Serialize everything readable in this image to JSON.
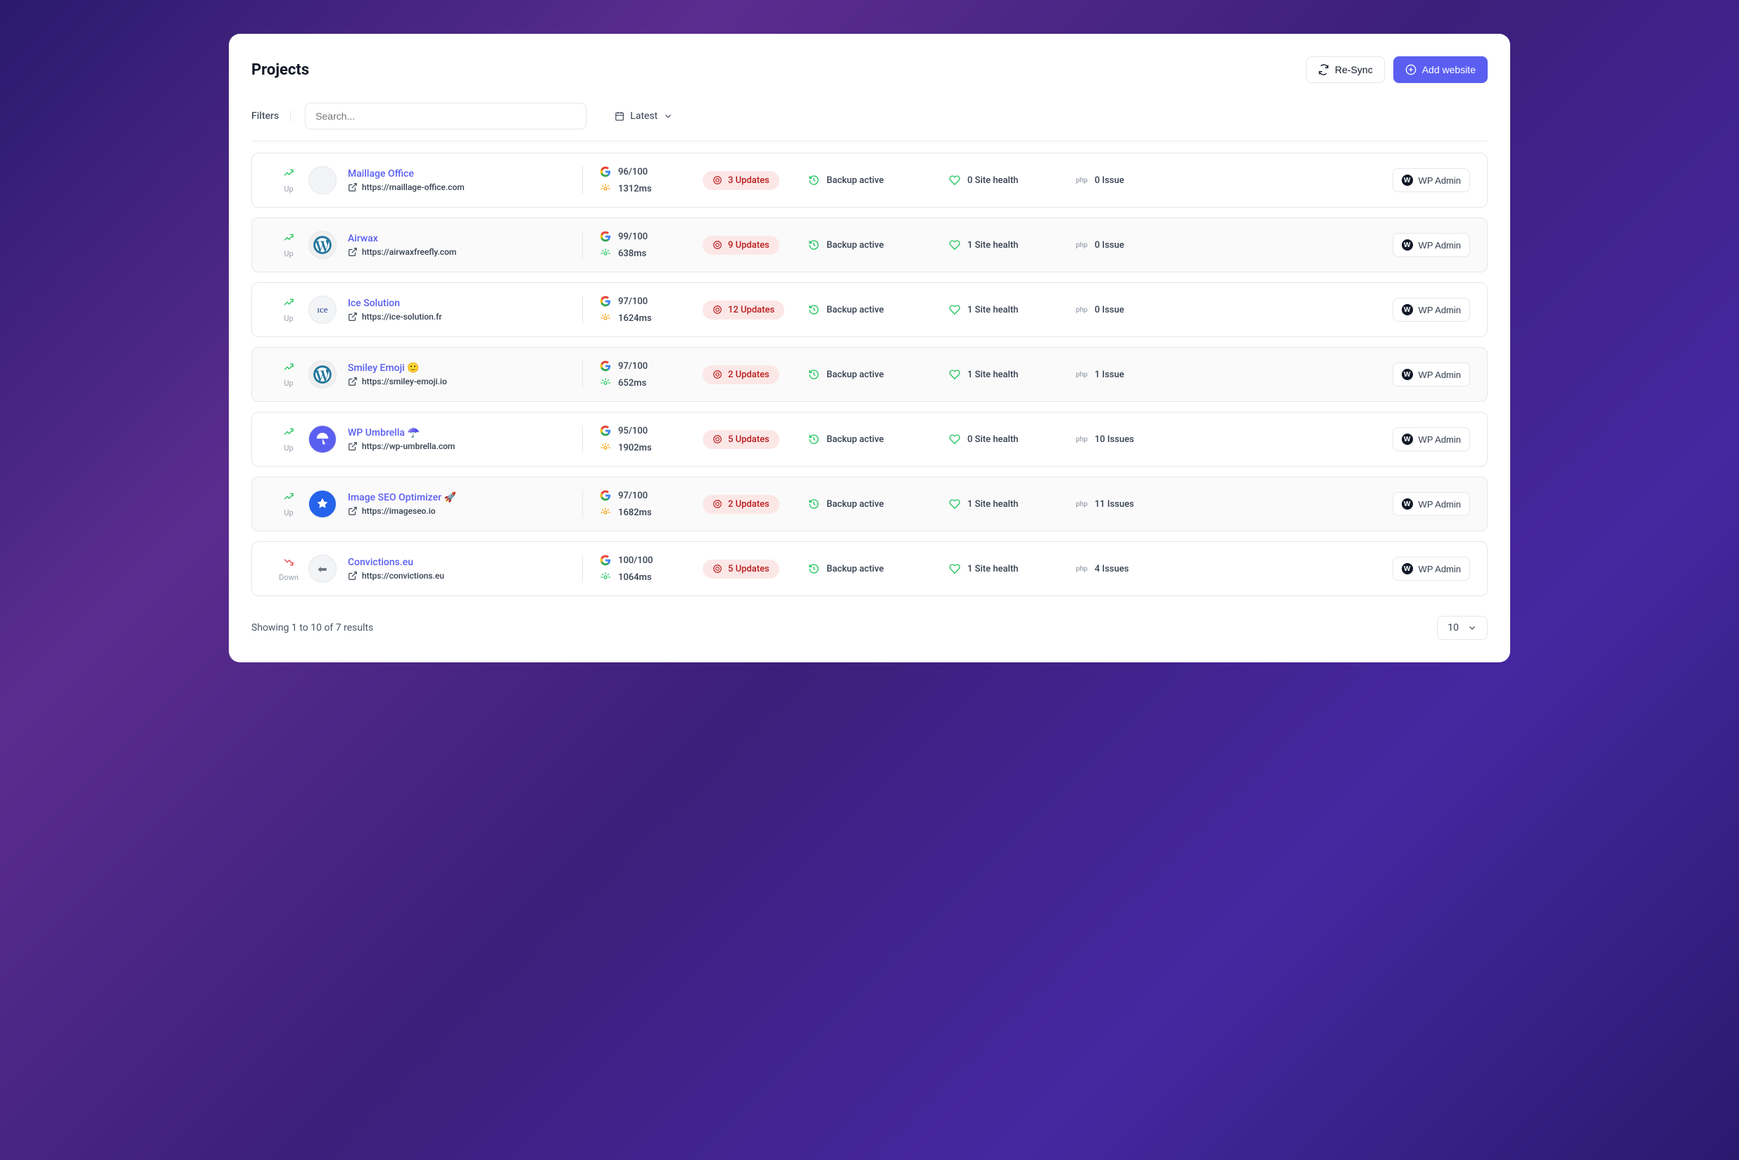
{
  "header": {
    "title": "Projects",
    "resync_label": "Re-Sync",
    "add_website_label": "Add website"
  },
  "toolbar": {
    "filters_label": "Filters",
    "search_placeholder": "Search...",
    "sort_label": "Latest"
  },
  "rows": [
    {
      "status": "Up",
      "trend": "up",
      "favicon": "blank",
      "name": "Maillage Office",
      "url": "https://maillage-office.com",
      "score": "96/100",
      "speed": "1312ms",
      "speed_color": "amber",
      "updates": "3 Updates",
      "backup": "Backup active",
      "health": "0 Site health",
      "issues": "0 Issue",
      "admin": "WP Admin"
    },
    {
      "status": "Up",
      "trend": "up",
      "favicon": "wp",
      "name": "Airwax",
      "url": "https://airwaxfreefly.com",
      "score": "99/100",
      "speed": "638ms",
      "speed_color": "green",
      "updates": "9 Updates",
      "backup": "Backup active",
      "health": "1 Site health",
      "issues": "0 Issue",
      "admin": "WP Admin"
    },
    {
      "status": "Up",
      "trend": "up",
      "favicon": "ice",
      "name": "Ice Solution",
      "url": "https://ice-solution.fr",
      "score": "97/100",
      "speed": "1624ms",
      "speed_color": "amber",
      "updates": "12 Updates",
      "backup": "Backup active",
      "health": "1 Site health",
      "issues": "0 Issue",
      "admin": "WP Admin"
    },
    {
      "status": "Up",
      "trend": "up",
      "favicon": "wp",
      "name": "Smiley Emoji 🙂",
      "url": "https://smiley-emoji.io",
      "score": "97/100",
      "speed": "652ms",
      "speed_color": "green",
      "updates": "2 Updates",
      "backup": "Backup active",
      "health": "1 Site health",
      "issues": "1 Issue",
      "admin": "WP Admin"
    },
    {
      "status": "Up",
      "trend": "up",
      "favicon": "umbrella",
      "name": "WP Umbrella ☂️",
      "url": "https://wp-umbrella.com",
      "score": "95/100",
      "speed": "1902ms",
      "speed_color": "amber",
      "updates": "5 Updates",
      "backup": "Backup active",
      "health": "0 Site health",
      "issues": "10 Issues",
      "admin": "WP Admin"
    },
    {
      "status": "Up",
      "trend": "up",
      "favicon": "imageseo",
      "name": "Image SEO Optimizer 🚀",
      "url": "https://imageseo.io",
      "score": "97/100",
      "speed": "1682ms",
      "speed_color": "amber",
      "updates": "2 Updates",
      "backup": "Backup active",
      "health": "1 Site health",
      "issues": "11 Issues",
      "admin": "WP Admin"
    },
    {
      "status": "Down",
      "trend": "down",
      "favicon": "conv",
      "name": "Convictions.eu",
      "url": "https://convictions.eu",
      "score": "100/100",
      "speed": "1064ms",
      "speed_color": "green",
      "updates": "5 Updates",
      "backup": "Backup active",
      "health": "1 Site health",
      "issues": "4 Issues",
      "admin": "WP Admin"
    }
  ],
  "footer": {
    "showing_text": "Showing 1 to 10 of 7 results",
    "page_size": "10"
  }
}
